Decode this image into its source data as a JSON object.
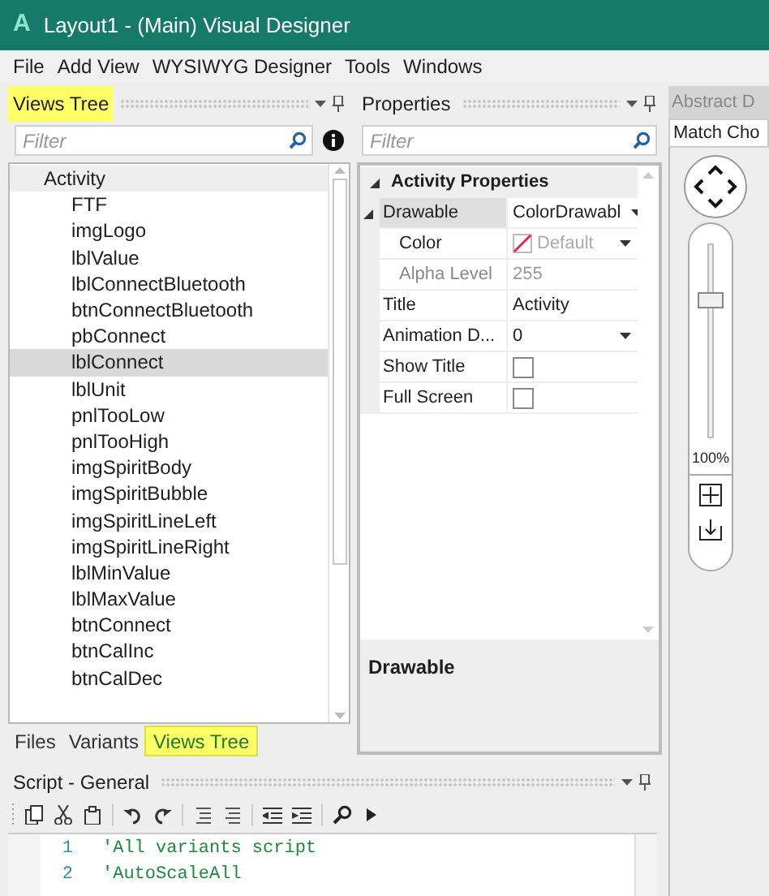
{
  "window": {
    "title": "Layout1 - (Main) Visual Designer",
    "icon_letter": "A"
  },
  "menu": [
    {
      "label": "File"
    },
    {
      "label": "Add View"
    },
    {
      "label": "WYSIWYG Designer"
    },
    {
      "label": "Tools"
    },
    {
      "label": "Windows"
    }
  ],
  "views_tree": {
    "title": "Views Tree",
    "highlighted": true,
    "filter_placeholder": "Filter",
    "items": [
      {
        "label": "Activity",
        "selected": false,
        "children": [
          {
            "label": "FTF",
            "selected": false
          },
          {
            "label": "imgLogo",
            "selected": false
          },
          {
            "label": "lblValue",
            "selected": false
          },
          {
            "label": "lblConnectBluetooth",
            "selected": false
          },
          {
            "label": "btnConnectBluetooth",
            "selected": false
          },
          {
            "label": "pbConnect",
            "selected": false
          },
          {
            "label": "lblConnect",
            "selected": true
          },
          {
            "label": "lblUnit",
            "selected": false
          },
          {
            "label": "pnlTooLow",
            "selected": false
          },
          {
            "label": "pnlTooHigh",
            "selected": false
          },
          {
            "label": "imgSpiritBody",
            "selected": false
          },
          {
            "label": "imgSpiritBubble",
            "selected": false
          },
          {
            "label": "imgSpiritLineLeft",
            "selected": false
          },
          {
            "label": "imgSpiritLineRight",
            "selected": false
          },
          {
            "label": "lblMinValue",
            "selected": false
          },
          {
            "label": "lblMaxValue",
            "selected": false
          },
          {
            "label": "btnConnect",
            "selected": false
          },
          {
            "label": "btnCalInc",
            "selected": false
          },
          {
            "label": "btnCalDec",
            "selected": false
          }
        ]
      }
    ]
  },
  "bottom_tabs": [
    {
      "label": "Files",
      "selected": false,
      "highlighted": false
    },
    {
      "label": "Variants",
      "selected": false,
      "highlighted": false
    },
    {
      "label": "Views Tree",
      "selected": true,
      "highlighted": true
    }
  ],
  "properties": {
    "title": "Properties",
    "filter_placeholder": "Filter",
    "rows": [
      {
        "kind": "category",
        "label": "Activity Properties",
        "expanded": true,
        "children": [
          {
            "kind": "dropdown",
            "label": "Drawable",
            "value": "ColorDrawabl",
            "selected": true,
            "expanded": true,
            "disabled": false,
            "children": [
              {
                "kind": "color",
                "label": "Color",
                "value": "Default",
                "selected": false,
                "disabled": true
              },
              {
                "kind": "text",
                "label": "Alpha Level",
                "value": "255",
                "selected": false,
                "disabled": true
              }
            ]
          },
          {
            "kind": "text",
            "label": "Title",
            "value": "Activity",
            "selected": false,
            "disabled": false
          },
          {
            "kind": "dropdown",
            "label": "Animation D...",
            "value": "0",
            "selected": false,
            "disabled": false
          },
          {
            "kind": "checkbox",
            "label": "Show Title",
            "checked": false,
            "selected": false,
            "disabled": false
          },
          {
            "kind": "checkbox",
            "label": "Full Screen",
            "checked": false,
            "selected": false,
            "disabled": false
          }
        ]
      }
    ],
    "description_title": "Drawable"
  },
  "script": {
    "title": "Script - General",
    "lines": [
      {
        "number": "1",
        "text": "'All variants script"
      },
      {
        "number": "2",
        "text": "'AutoScaleAll"
      }
    ]
  },
  "abstract_designer": {
    "title": "Abstract D",
    "field_value": "Match Cho",
    "level": 0.73,
    "zoom_label": "100%"
  }
}
